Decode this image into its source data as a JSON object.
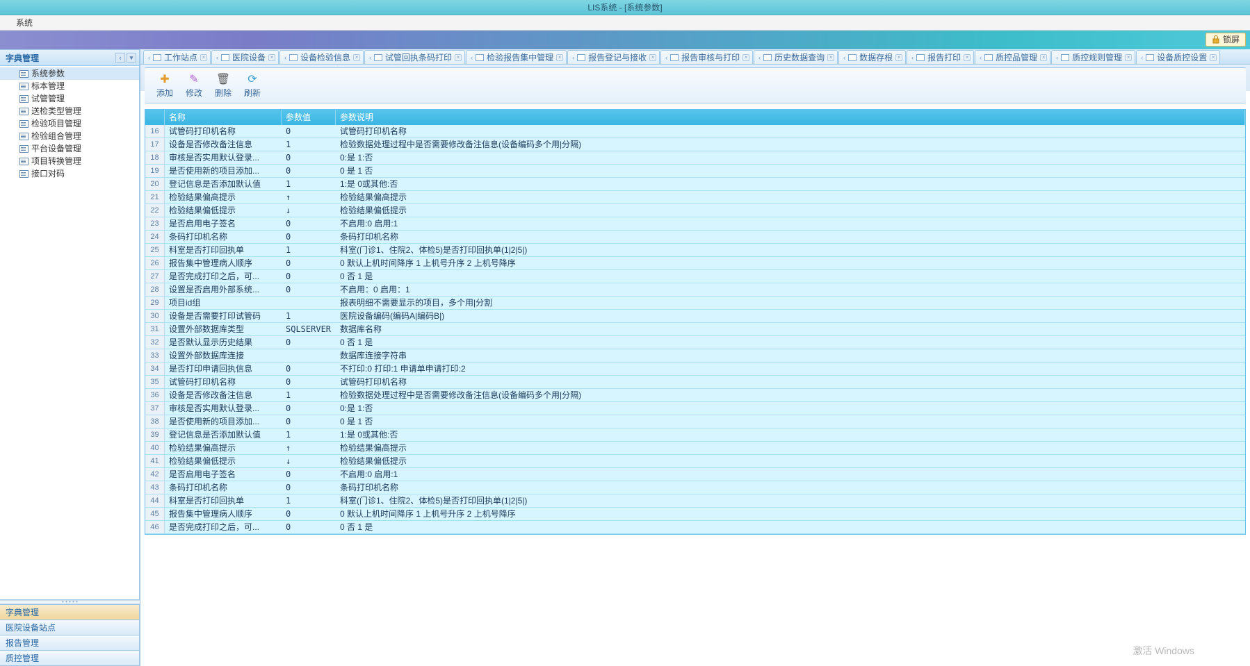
{
  "title": "LIS系统 - [系统参数]",
  "menu": {
    "system": "系统"
  },
  "lock": "锁屏",
  "sidebar": {
    "header": "字典管理",
    "items": [
      {
        "label": "系统参数",
        "sel": true
      },
      {
        "label": "标本管理"
      },
      {
        "label": "试管管理"
      },
      {
        "label": "送检类型管理"
      },
      {
        "label": "检验项目管理"
      },
      {
        "label": "检验组合管理"
      },
      {
        "label": "平台设备管理"
      },
      {
        "label": "项目转换管理"
      },
      {
        "label": "接口对码"
      }
    ],
    "accordion": [
      "字典管理",
      "医院设备站点",
      "报告管理",
      "质控管理"
    ]
  },
  "tabs": [
    "工作站点",
    "医院设备",
    "设备检验信息",
    "试管回执条码打印",
    "检验报告集中管理",
    "报告登记与接收",
    "报告审核与打印",
    "历史数据查询",
    "数据存根",
    "报告打印",
    "质控品管理",
    "质控规则管理",
    "设备质控设置"
  ],
  "toolbar": {
    "add": "添加",
    "edit": "修改",
    "del": "删除",
    "refresh": "刷新"
  },
  "grid": {
    "headers": {
      "name": "名称",
      "value": "参数值",
      "desc": "参数说明"
    },
    "rows": [
      {
        "n": 16,
        "name": "试管码打印机名称",
        "val": "0",
        "desc": "试管码打印机名称"
      },
      {
        "n": 17,
        "name": "设备是否修改备注信息",
        "val": "1",
        "desc": "检验数据处理过程中是否需要修改备注信息(设备编码多个用|分隔)"
      },
      {
        "n": 18,
        "name": "审核是否实用默认登录...",
        "val": "0",
        "desc": "0:是 1:否"
      },
      {
        "n": 19,
        "name": "是否使用新的项目添加...",
        "val": "0",
        "desc": "0 是 1 否"
      },
      {
        "n": 20,
        "name": "登记信息是否添加默认值",
        "val": "1",
        "desc": "1:是 0或其他:否"
      },
      {
        "n": 21,
        "name": "检验结果偏高提示",
        "val": "↑",
        "desc": "检验结果偏高提示"
      },
      {
        "n": 22,
        "name": "检验结果偏低提示",
        "val": "↓",
        "desc": "检验结果偏低提示"
      },
      {
        "n": 23,
        "name": "是否启用电子签名",
        "val": "0",
        "desc": "不启用:0 启用:1"
      },
      {
        "n": 24,
        "name": "条码打印机名称",
        "val": "0",
        "desc": "条码打印机名称"
      },
      {
        "n": 25,
        "name": "科室是否打印回执单",
        "val": "1",
        "desc": "科室(门诊1、住院2、体检5)是否打印回执单(1|2|5|)"
      },
      {
        "n": 26,
        "name": "报告集中管理病人顺序",
        "val": "0",
        "desc": "0 默认上机时间降序  1 上机号升序  2 上机号降序"
      },
      {
        "n": 27,
        "name": "是否完成打印之后，可...",
        "val": "0",
        "desc": "0 否 1 是"
      },
      {
        "n": 28,
        "name": "设置是否启用外部系统...",
        "val": "0",
        "desc": "不启用：0 启用：1"
      },
      {
        "n": 29,
        "name": "项目id组",
        "val": "",
        "desc": "报表明细不需要显示的项目，多个用|分割"
      },
      {
        "n": 30,
        "name": "设备是否需要打印试管码",
        "val": "1",
        "desc": "医院设备编码(编码A|编码B|)"
      },
      {
        "n": 31,
        "name": "设置外部数据库类型",
        "val": "SQLSERVER",
        "desc": "数据库名称"
      },
      {
        "n": 32,
        "name": "是否默认显示历史结果",
        "val": "0",
        "desc": "0 否  1 是"
      },
      {
        "n": 33,
        "name": "设置外部数据库连接",
        "val": "",
        "desc": "数据库连接字符串"
      },
      {
        "n": 34,
        "name": "是否打印申请回执信息",
        "val": "0",
        "desc": "不打印:0 打印:1 申请单申请打印:2"
      },
      {
        "n": 35,
        "name": "试管码打印机名称",
        "val": "0",
        "desc": "试管码打印机名称"
      },
      {
        "n": 36,
        "name": "设备是否修改备注信息",
        "val": "1",
        "desc": "检验数据处理过程中是否需要修改备注信息(设备编码多个用|分隔)"
      },
      {
        "n": 37,
        "name": "审核是否实用默认登录...",
        "val": "0",
        "desc": "0:是 1:否"
      },
      {
        "n": 38,
        "name": "是否使用新的项目添加...",
        "val": "0",
        "desc": "0 是 1 否"
      },
      {
        "n": 39,
        "name": "登记信息是否添加默认值",
        "val": "1",
        "desc": "1:是 0或其他:否"
      },
      {
        "n": 40,
        "name": "检验结果偏高提示",
        "val": "↑",
        "desc": "检验结果偏高提示"
      },
      {
        "n": 41,
        "name": "检验结果偏低提示",
        "val": "↓",
        "desc": "检验结果偏低提示"
      },
      {
        "n": 42,
        "name": "是否启用电子签名",
        "val": "0",
        "desc": "不启用:0 启用:1"
      },
      {
        "n": 43,
        "name": "条码打印机名称",
        "val": "0",
        "desc": "条码打印机名称"
      },
      {
        "n": 44,
        "name": "科室是否打印回执单",
        "val": "1",
        "desc": "科室(门诊1、住院2、体检5)是否打印回执单(1|2|5|)"
      },
      {
        "n": 45,
        "name": "报告集中管理病人顺序",
        "val": "0",
        "desc": "0 默认上机时间降序  1 上机号升序  2 上机号降序"
      },
      {
        "n": 46,
        "name": "是否完成打印之后，可...",
        "val": "0",
        "desc": "0 否 1 是"
      }
    ]
  },
  "watermark": "激活 Windows"
}
